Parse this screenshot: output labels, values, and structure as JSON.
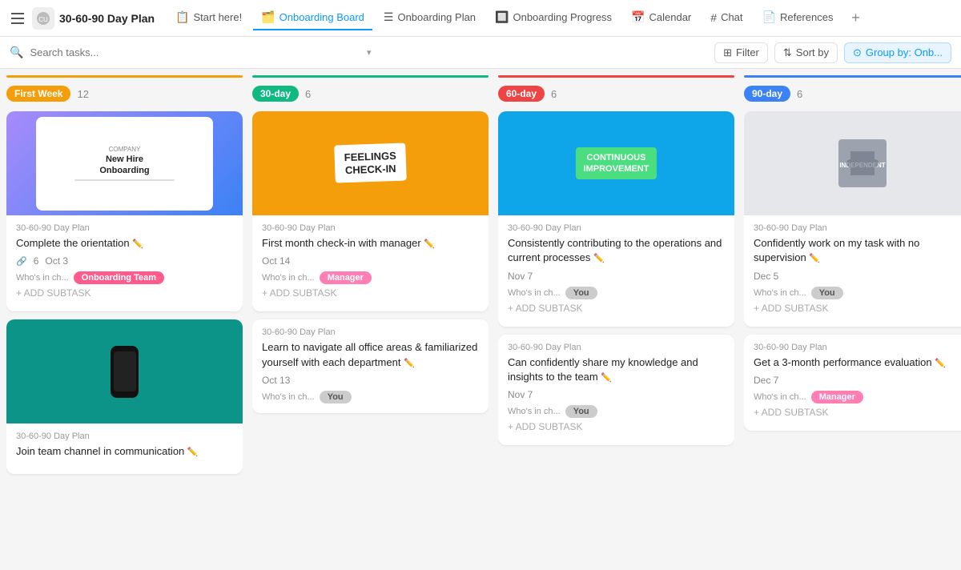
{
  "app": {
    "hamburger_label": "menu",
    "logo_label": "CU",
    "project_title": "30-60-90 Day Plan"
  },
  "nav": {
    "tabs": [
      {
        "id": "start",
        "label": "Start here!",
        "icon": "📋",
        "active": false
      },
      {
        "id": "onboarding-board",
        "label": "Onboarding Board",
        "icon": "🗂️",
        "active": true
      },
      {
        "id": "onboarding-plan",
        "label": "Onboarding Plan",
        "icon": "☰",
        "active": false
      },
      {
        "id": "onboarding-progress",
        "label": "Onboarding Progress",
        "icon": "🔲",
        "active": false
      },
      {
        "id": "calendar",
        "label": "Calendar",
        "icon": "📅",
        "active": false
      },
      {
        "id": "chat",
        "label": "Chat",
        "icon": "#",
        "active": false
      },
      {
        "id": "references",
        "label": "References",
        "icon": "📄",
        "active": false
      }
    ],
    "plus_label": "+"
  },
  "toolbar": {
    "search_placeholder": "Search tasks...",
    "search_arrow": "▾",
    "filter_label": "Filter",
    "sortby_label": "Sort by",
    "groupby_label": "Group by: Onb..."
  },
  "columns": [
    {
      "id": "first-week",
      "badge_label": "First Week",
      "badge_color": "#f59e0b",
      "bar_color": "#f59e0b",
      "count": "12",
      "cards": [
        {
          "id": "c1",
          "img_type": "onboarding",
          "img_alt": "New Hire Onboarding image",
          "project": "30-60-90 Day Plan",
          "title": "Complete the orientation",
          "subtask_count": "6",
          "date": "Oct 3",
          "assignee_label": "Who's in ch...",
          "badge": "Onboarding Team",
          "badge_class": "badge-onboarding",
          "has_add_subtask": true
        },
        {
          "id": "c2",
          "img_type": "phone",
          "img_alt": "Communication channel image",
          "project": "30-60-90 Day Plan",
          "title": "Join team channel in communication",
          "subtask_count": null,
          "date": null,
          "assignee_label": null,
          "badge": null,
          "badge_class": null,
          "has_add_subtask": false
        }
      ]
    },
    {
      "id": "thirty-day",
      "badge_label": "30-day",
      "badge_color": "#10b981",
      "bar_color": "#10b981",
      "count": "6",
      "cards": [
        {
          "id": "c3",
          "img_type": "feelings",
          "img_alt": "Feelings check-in image",
          "project": "30-60-90 Day Plan",
          "title": "First month check-in with manager",
          "subtask_count": null,
          "date": "Oct 14",
          "assignee_label": "Who's in ch...",
          "badge": "Manager",
          "badge_class": "badge-manager",
          "has_add_subtask": true
        },
        {
          "id": "c4",
          "img_type": null,
          "img_alt": null,
          "project": "30-60-90 Day Plan",
          "title": "Learn to navigate all office areas & familiarized yourself with each department",
          "subtask_count": null,
          "date": "Oct 13",
          "assignee_label": "Who's in ch...",
          "badge": "You",
          "badge_class": "badge-you",
          "has_add_subtask": false
        }
      ]
    },
    {
      "id": "sixty-day",
      "badge_label": "60-day",
      "badge_color": "#ef4444",
      "bar_color": "#ef4444",
      "count": "6",
      "cards": [
        {
          "id": "c5",
          "img_type": "continuous",
          "img_alt": "Continuous improvement image",
          "project": "30-60-90 Day Plan",
          "title": "Consistently contributing to the operations and current processes",
          "subtask_count": null,
          "date": "Nov 7",
          "assignee_label": "Who's in ch...",
          "badge": "You",
          "badge_class": "badge-you",
          "has_add_subtask": true
        },
        {
          "id": "c6",
          "img_type": null,
          "img_alt": null,
          "project": "30-60-90 Day Plan",
          "title": "Can confidently share my knowledge and insights to the team",
          "subtask_count": null,
          "date": "Nov 7",
          "assignee_label": "Who's in ch...",
          "badge": "You",
          "badge_class": "badge-you",
          "has_add_subtask": true
        }
      ]
    },
    {
      "id": "ninety-day",
      "badge_label": "90-day",
      "badge_color": "#3b82f6",
      "bar_color": "#3b82f6",
      "count": "6",
      "cards": [
        {
          "id": "c7",
          "img_type": "independent",
          "img_alt": "Independent puzzle image",
          "project": "30-60-90 Day Plan",
          "title": "Confidently work on my task with no supervision",
          "subtask_count": null,
          "date": "Dec 5",
          "assignee_label": "Who's in ch...",
          "badge": "You",
          "badge_class": "badge-you",
          "has_add_subtask": true
        },
        {
          "id": "c8",
          "img_type": null,
          "img_alt": null,
          "project": "30-60-90 Day Plan",
          "title": "Get a 3-month performance evaluation",
          "subtask_count": null,
          "date": "Dec 7",
          "assignee_label": "Who's in ch...",
          "badge": "Manager",
          "badge_class": "badge-manager",
          "has_add_subtask": true
        }
      ]
    }
  ],
  "icons": {
    "search": "🔍",
    "filter": "⊞",
    "sort": "⇅",
    "group": "⊙"
  },
  "add_subtask_label": "+ ADD SUBTASK"
}
